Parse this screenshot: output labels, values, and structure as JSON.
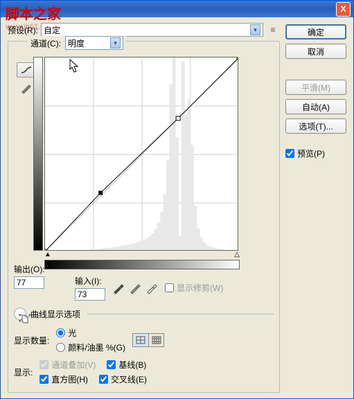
{
  "watermark": {
    "line1": "脚本之家",
    "line2": "www.jb51.net"
  },
  "titlebar": {
    "close": "X"
  },
  "preset": {
    "label": "预设(R):",
    "value": "自定"
  },
  "channel": {
    "label": "通道(C):",
    "value": "明度"
  },
  "output": {
    "label": "输出(O):",
    "value": "77"
  },
  "input": {
    "label": "输入(I):",
    "value": "73"
  },
  "show_clipping": "显示修剪(W)",
  "curve_disclosure": "曲线显示选项",
  "show_amount": {
    "label": "显示数量:",
    "opt_light": "光",
    "opt_pigment": "颜料/油墨 %(G)"
  },
  "show_opts": {
    "label": "显示:",
    "channel_overlay": "通道叠加(V)",
    "baseline": "基线(B)",
    "histogram": "直方图(H)",
    "intersection": "交叉线(E)"
  },
  "buttons": {
    "ok": "确定",
    "cancel": "取消",
    "smooth": "平滑(M)",
    "auto": "自动(A)",
    "options": "选项(T)...",
    "preview": "预览(P)"
  },
  "chart_data": {
    "type": "line",
    "title": "",
    "xlabel": "输入",
    "ylabel": "输出",
    "xlim": [
      0,
      255
    ],
    "ylim": [
      0,
      255
    ],
    "series": [
      {
        "name": "baseline",
        "x": [
          0,
          255
        ],
        "y": [
          0,
          255
        ]
      },
      {
        "name": "curve",
        "x": [
          0,
          73,
          175,
          255
        ],
        "y": [
          0,
          77,
          175,
          255
        ]
      }
    ],
    "control_points": [
      {
        "x": 73,
        "y": 77,
        "selected": true
      },
      {
        "x": 175,
        "y": 175,
        "selected": false
      }
    ],
    "histogram": [
      0,
      0,
      0,
      0,
      0,
      0,
      0,
      0,
      0,
      1,
      1,
      1,
      2,
      2,
      2,
      3,
      3,
      3,
      4,
      4,
      5,
      5,
      6,
      6,
      7,
      8,
      8,
      9,
      10,
      11,
      12,
      14,
      15,
      17,
      20,
      24,
      30,
      38,
      52,
      75,
      120,
      220,
      255,
      150,
      20,
      250,
      180,
      200,
      140,
      60,
      30,
      18,
      12,
      8,
      6,
      5,
      4,
      3,
      3,
      2,
      2,
      2,
      1,
      1
    ]
  }
}
